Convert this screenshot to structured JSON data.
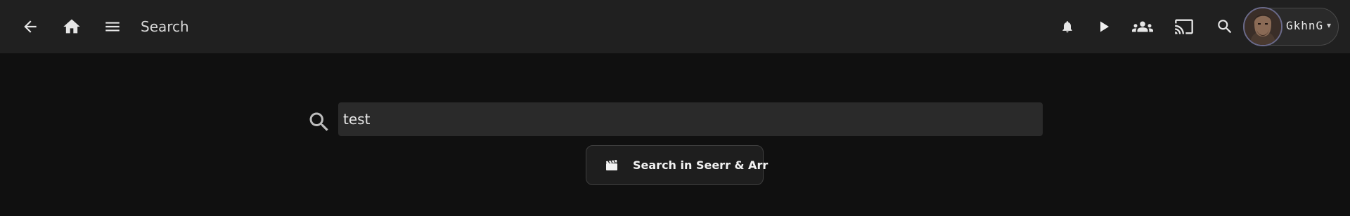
{
  "header": {
    "title": "Search",
    "icons": {
      "back": "arrow-left-icon",
      "home": "home-icon",
      "menu": "hamburger-menu-icon",
      "notifications": "bell-icon",
      "play": "play-icon",
      "users": "group-icon",
      "cast": "cast-icon",
      "search": "search-icon"
    },
    "user": {
      "name": "GkhnG",
      "caret": "▾"
    }
  },
  "search": {
    "value": "test",
    "placeholder": ""
  },
  "seerr_button": {
    "label": "Search in Seerr & Arr",
    "icon": "clapperboard-icon"
  },
  "colors": {
    "background": "#101010",
    "header": "#202020",
    "input": "#2a2a2a"
  }
}
